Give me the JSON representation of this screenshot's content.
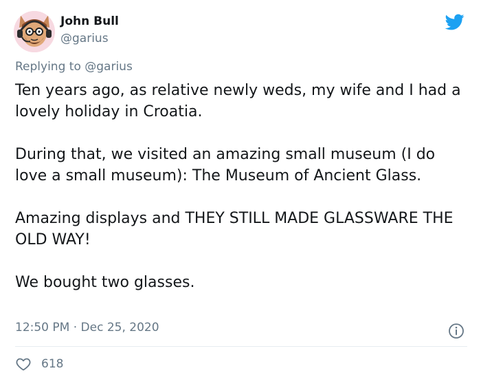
{
  "tweet": {
    "author_name": "John Bull",
    "author_handle": "@garius",
    "reply_prefix": "Replying to",
    "reply_to": "@garius",
    "paragraphs": [
      "Ten years ago, as relative newly weds, my wife and I had a lovely holiday in Croatia.",
      "During that, we visited an amazing small museum (I do love a small museum): The Museum of Ancient Glass.",
      "Amazing displays and THEY STILL MADE GLASSWARE THE OLD WAY!",
      "We bought two glasses."
    ],
    "time": "12:50 PM",
    "separator": "·",
    "date": "Dec 25, 2020",
    "likes": "618"
  },
  "icons": {
    "brand": "twitter-bird-icon",
    "info": "info-icon",
    "like": "heart-icon"
  },
  "colors": {
    "brand_blue": "#1DA1F2",
    "secondary_text": "#657786",
    "primary_text": "#14171A",
    "divider": "#E6ECF0"
  }
}
